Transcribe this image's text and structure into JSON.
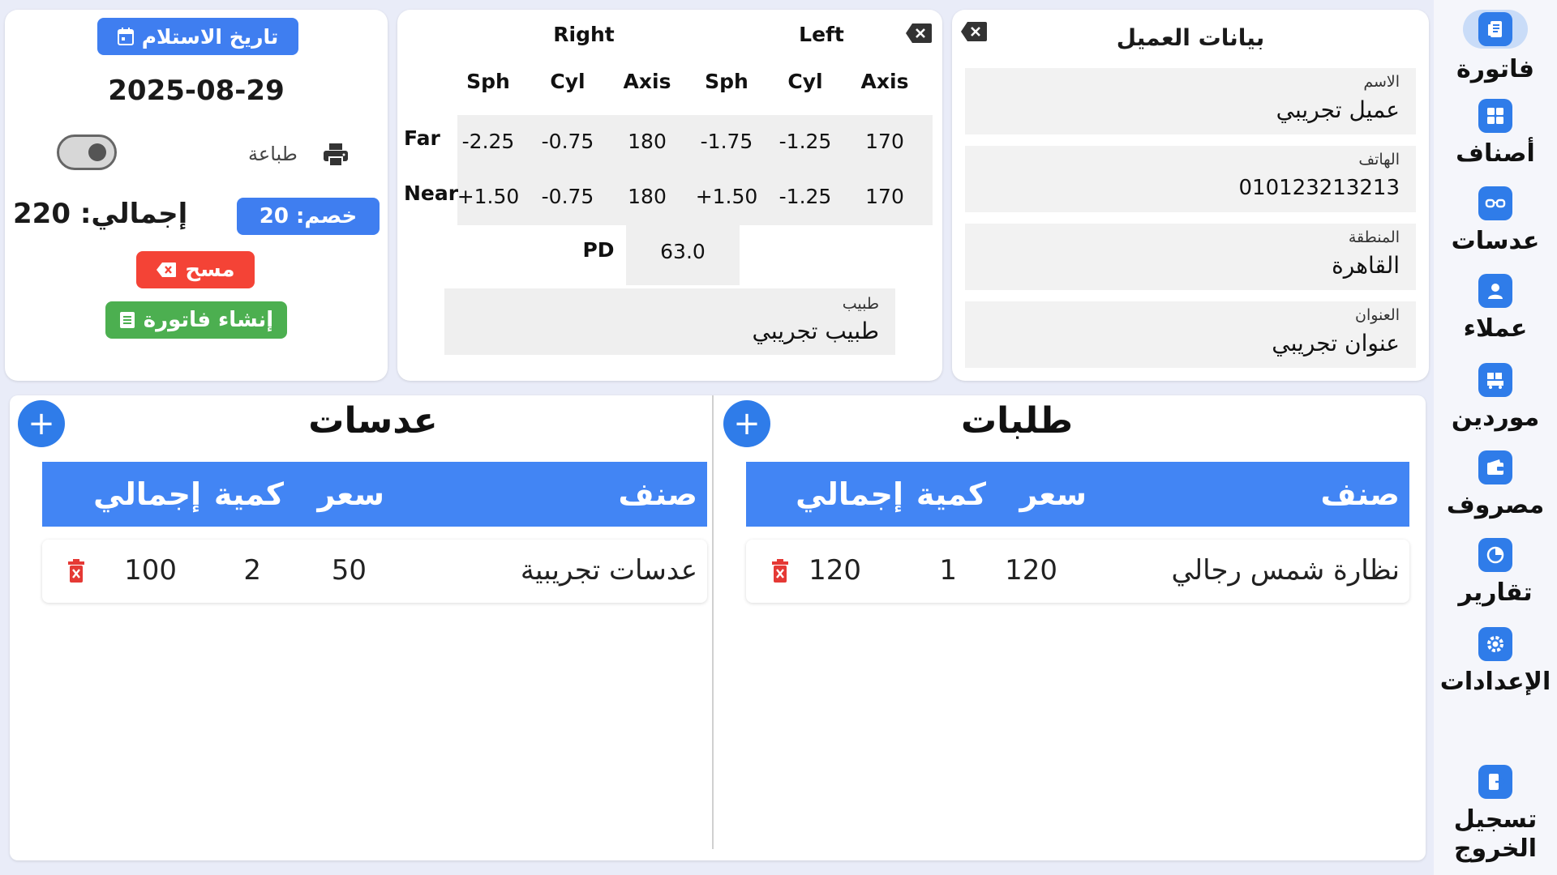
{
  "sidebar": {
    "items": [
      {
        "label": "فاتورة",
        "icon": "invoice-icon",
        "active": true
      },
      {
        "label": "أصناف",
        "icon": "grid-icon"
      },
      {
        "label": "عدسات",
        "icon": "glasses-icon"
      },
      {
        "label": "عملاء",
        "icon": "user-icon"
      },
      {
        "label": "موردين",
        "icon": "supplier-icon"
      },
      {
        "label": "مصروف",
        "icon": "wallet-icon"
      },
      {
        "label": "تقارير",
        "icon": "pie-chart-icon"
      },
      {
        "label": "الإعدادات",
        "icon": "gear-icon"
      }
    ],
    "logout": {
      "line1": "تسجيل",
      "line2": "الخروج",
      "icon": "logout-icon"
    }
  },
  "customer": {
    "title": "بيانات العميل",
    "fields": [
      {
        "label": "الاسم",
        "value": "عميل تجريبي"
      },
      {
        "label": "الهاتف",
        "value": "010123213213"
      },
      {
        "label": "المنطقة",
        "value": "القاهرة"
      },
      {
        "label": "العنوان",
        "value": "عنوان تجريبي"
      }
    ]
  },
  "prescription": {
    "right_label": "Right",
    "left_label": "Left",
    "columns": [
      "Sph",
      "Cyl",
      "Axis",
      "Sph",
      "Cyl",
      "Axis"
    ],
    "rows": [
      {
        "label": "Far",
        "values": [
          "-2.25",
          "-0.75",
          "180",
          "-1.75",
          "-1.25",
          "170"
        ]
      },
      {
        "label": "Near",
        "values": [
          "+1.50",
          "-0.75",
          "180",
          "+1.50",
          "-1.25",
          "170"
        ]
      }
    ],
    "pd_label": "PD",
    "pd_value": "63.0",
    "doctor_label": "طبيب",
    "doctor_value": "طبيب تجريبي"
  },
  "summary": {
    "receive_date_label": "تاريخ الاستلام",
    "receive_date": "2025-08-29",
    "print_label": "طباعة",
    "print_enabled": false,
    "discount_label": "خصم: 20",
    "total_label": "إجمالي: 220",
    "clear_label": "مسح",
    "create_invoice_label": "إنشاء فاتورة"
  },
  "orders": {
    "title": "طلبات",
    "headers": {
      "item": "صنف",
      "price": "سعر",
      "qty": "كمية",
      "total": "إجمالي"
    },
    "rows": [
      {
        "item": "نظارة شمس رجالي",
        "price": "120",
        "qty": "1",
        "total": "120"
      }
    ]
  },
  "lenses": {
    "title": "عدسات",
    "headers": {
      "item": "صنف",
      "price": "سعر",
      "qty": "كمية",
      "total": "إجمالي"
    },
    "rows": [
      {
        "item": "عدسات تجريبية",
        "price": "50",
        "qty": "2",
        "total": "100"
      }
    ]
  },
  "colors": {
    "primary": "#2f7ce9",
    "table_header": "#4285f4",
    "danger": "#f44336",
    "success": "#4caf50",
    "background": "#e9ecf8"
  }
}
